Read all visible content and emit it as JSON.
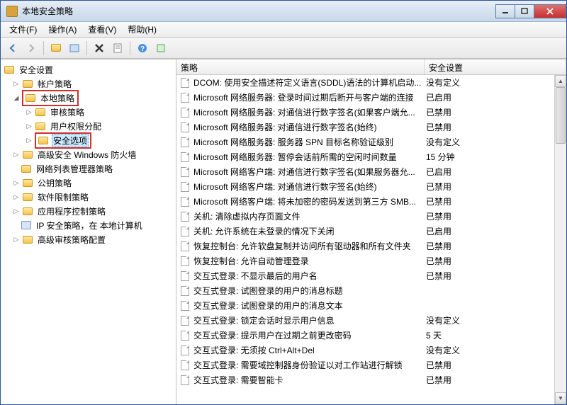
{
  "window": {
    "title": "本地安全策略"
  },
  "menu": {
    "file": "文件(F)",
    "action": "操作(A)",
    "view": "查看(V)",
    "help": "帮助(H)"
  },
  "tree": {
    "root": "安全设置",
    "account": "帐户策略",
    "local": "本地策略",
    "audit": "审核策略",
    "rights": "用户权限分配",
    "options": "安全选项",
    "firewall": "高级安全 Windows 防火墙",
    "netlist": "网络列表管理器策略",
    "pubkey": "公钥策略",
    "softrestrict": "软件限制策略",
    "appctrl": "应用程序控制策略",
    "ipsec": "IP 安全策略，在 本地计算机",
    "advaudit": "高级审核策略配置"
  },
  "columns": {
    "policy": "策略",
    "setting": "安全设置"
  },
  "rows": [
    {
      "p": "DCOM: 使用安全描述符定义语言(SDDL)语法的计算机启动...",
      "s": "没有定义"
    },
    {
      "p": "Microsoft 网络服务器: 登录时间过期后断开与客户端的连接",
      "s": "已启用"
    },
    {
      "p": "Microsoft 网络服务器: 对通信进行数字签名(如果客户端允...",
      "s": "已禁用"
    },
    {
      "p": "Microsoft 网络服务器: 对通信进行数字签名(始终)",
      "s": "已禁用"
    },
    {
      "p": "Microsoft 网络服务器: 服务器 SPN 目标名称验证级别",
      "s": "没有定义"
    },
    {
      "p": "Microsoft 网络服务器: 暂停会话前所需的空闲时间数量",
      "s": "15 分钟"
    },
    {
      "p": "Microsoft 网络客户端: 对通信进行数字签名(如果服务器允...",
      "s": "已启用"
    },
    {
      "p": "Microsoft 网络客户端: 对通信进行数字签名(始终)",
      "s": "已禁用"
    },
    {
      "p": "Microsoft 网络客户端: 将未加密的密码发送到第三方 SMB...",
      "s": "已禁用"
    },
    {
      "p": "关机: 清除虚拟内存页面文件",
      "s": "已禁用"
    },
    {
      "p": "关机: 允许系统在未登录的情况下关闭",
      "s": "已启用"
    },
    {
      "p": "恢复控制台: 允许软盘复制并访问所有驱动器和所有文件夹",
      "s": "已禁用"
    },
    {
      "p": "恢复控制台: 允许自动管理登录",
      "s": "已禁用"
    },
    {
      "p": "交互式登录: 不显示最后的用户名",
      "s": "已禁用"
    },
    {
      "p": "交互式登录: 试图登录的用户的消息标题",
      "s": ""
    },
    {
      "p": "交互式登录: 试图登录的用户的消息文本",
      "s": ""
    },
    {
      "p": "交互式登录: 锁定会话时显示用户信息",
      "s": "没有定义"
    },
    {
      "p": "交互式登录: 提示用户在过期之前更改密码",
      "s": "5 天"
    },
    {
      "p": "交互式登录: 无须按 Ctrl+Alt+Del",
      "s": "没有定义"
    },
    {
      "p": "交互式登录: 需要域控制器身份验证以对工作站进行解锁",
      "s": "已禁用"
    },
    {
      "p": "交互式登录: 需要智能卡",
      "s": "已禁用"
    }
  ]
}
